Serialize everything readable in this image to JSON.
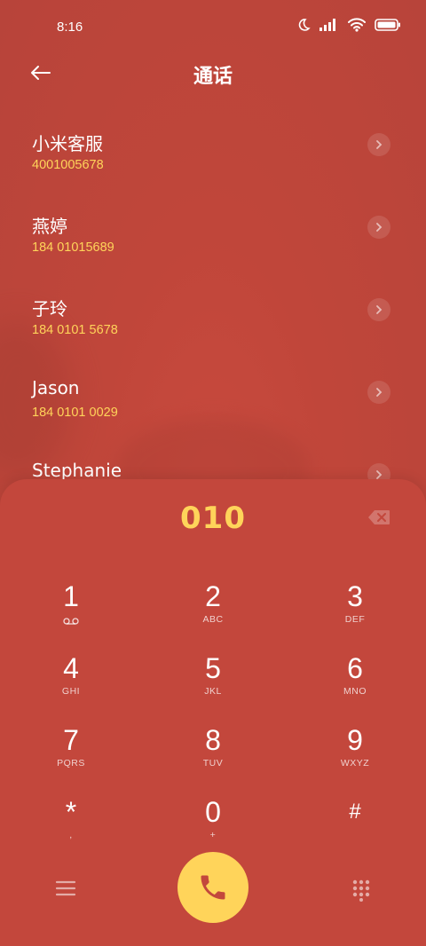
{
  "status_bar": {
    "time": "8:16"
  },
  "header": {
    "title": "通话"
  },
  "contacts": [
    {
      "name": "小米客服",
      "number": "4001005678"
    },
    {
      "name": "燕婷",
      "number": "184 01015689"
    },
    {
      "name": "子玲",
      "number": "184 0101 5678"
    },
    {
      "name": "Jason",
      "number": "184 0101 0029"
    },
    {
      "name": "Stephanie",
      "number": ""
    }
  ],
  "dialer": {
    "number": "010",
    "keys": [
      {
        "digit": "1",
        "letters": ""
      },
      {
        "digit": "2",
        "letters": "ABC"
      },
      {
        "digit": "3",
        "letters": "DEF"
      },
      {
        "digit": "4",
        "letters": "GHI"
      },
      {
        "digit": "5",
        "letters": "JKL"
      },
      {
        "digit": "6",
        "letters": "MNO"
      },
      {
        "digit": "7",
        "letters": "PQRS"
      },
      {
        "digit": "8",
        "letters": "TUV"
      },
      {
        "digit": "9",
        "letters": "WXYZ"
      },
      {
        "digit": "*",
        "letters": ","
      },
      {
        "digit": "0",
        "letters": "+"
      },
      {
        "digit": "#",
        "letters": ""
      }
    ]
  },
  "colors": {
    "background": "#c0463a",
    "accent": "#ffd45a"
  },
  "icons": {
    "back": "arrow-left-icon",
    "call": "phone-icon",
    "menu": "menu-icon",
    "keypad": "keypad-icon",
    "backspace": "backspace-icon",
    "voicemail": "voicemail-icon"
  }
}
